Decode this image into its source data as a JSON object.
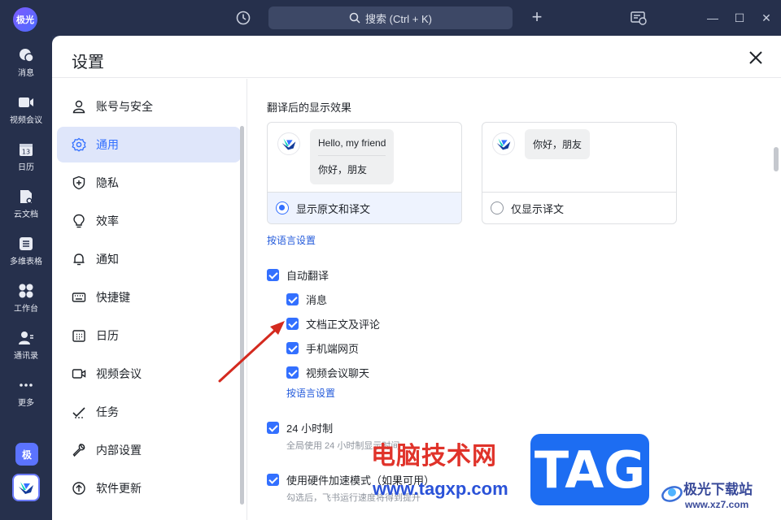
{
  "app": {
    "avatar_text": "极光"
  },
  "topbar": {
    "search_label": "搜索 (Ctrl + K)",
    "minimize": "—",
    "maximize": "☐",
    "close": "✕"
  },
  "leftnav": {
    "items": [
      {
        "label": "消息",
        "icon": "message-icon"
      },
      {
        "label": "视频会议",
        "icon": "video-icon"
      },
      {
        "label": "日历",
        "icon": "calendar-icon"
      },
      {
        "label": "云文档",
        "icon": "doc-icon"
      },
      {
        "label": "多维表格",
        "icon": "table-icon"
      },
      {
        "label": "工作台",
        "icon": "workspace-icon"
      },
      {
        "label": "通讯录",
        "icon": "contacts-icon"
      },
      {
        "label": "更多",
        "icon": "more-icon"
      }
    ],
    "ji_badge": "极",
    "calendar_day": "13"
  },
  "settings": {
    "title": "设置",
    "sidebar": [
      {
        "label": "账号与安全",
        "icon": "user-icon",
        "active": false
      },
      {
        "label": "通用",
        "icon": "gear-icon",
        "active": true
      },
      {
        "label": "隐私",
        "icon": "shield-icon",
        "active": false
      },
      {
        "label": "效率",
        "icon": "bulb-icon",
        "active": false
      },
      {
        "label": "通知",
        "icon": "bell-icon",
        "active": false
      },
      {
        "label": "快捷键",
        "icon": "keyboard-icon",
        "active": false
      },
      {
        "label": "日历",
        "icon": "calendar-icon",
        "active": false
      },
      {
        "label": "视频会议",
        "icon": "video-icon",
        "active": false
      },
      {
        "label": "任务",
        "icon": "task-icon",
        "active": false
      },
      {
        "label": "内部设置",
        "icon": "wrench-icon",
        "active": false
      },
      {
        "label": "软件更新",
        "icon": "update-icon",
        "active": false
      }
    ],
    "translation": {
      "section_title": "翻译后的显示效果",
      "card_a": {
        "bubble_line1": "Hello, my friend",
        "bubble_line2": "你好，朋友",
        "option": "显示原文和译文",
        "selected": true
      },
      "card_b": {
        "bubble_line1": "你好，朋友",
        "option": "仅显示译文",
        "selected": false
      },
      "lang_link": "按语言设置"
    },
    "auto_translate": {
      "label": "自动翻译",
      "checked": true,
      "children": [
        {
          "label": "消息",
          "checked": true
        },
        {
          "label": "文档正文及评论",
          "checked": true
        },
        {
          "label": "手机端网页",
          "checked": true
        },
        {
          "label": "视频会议聊天",
          "checked": true
        }
      ],
      "lang_link": "按语言设置"
    },
    "clock24": {
      "label": "24 小时制",
      "checked": true,
      "hint": "全局使用 24 小时制显示时间"
    },
    "hw_accel": {
      "label": "使用硬件加速模式（如果可用）",
      "checked": true,
      "hint": "勾选后，飞书运行速度将得到提升"
    }
  },
  "watermarks": {
    "cn_site": "电脑技术网",
    "url": "www.tagxp.com",
    "tag": "TAG",
    "xz_name": "极光下载站",
    "xz_url": "www.xz7.com"
  },
  "colors": {
    "accent": "#3370ff",
    "nav_bg": "#26304c",
    "active_bg": "#dfe6fa"
  }
}
